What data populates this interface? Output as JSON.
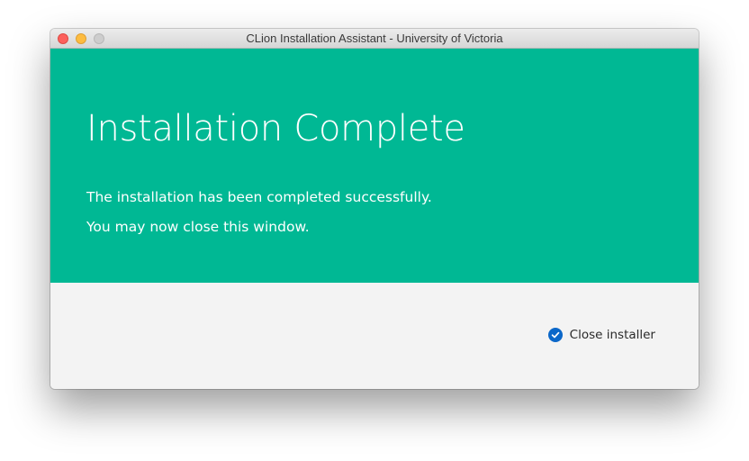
{
  "window": {
    "title": "CLion Installation Assistant - University of Victoria"
  },
  "hero": {
    "title": "Installation Complete",
    "line1": "The installation has been completed successfully.",
    "line2": "You may now close this window."
  },
  "footer": {
    "close_option_label": "Close installer",
    "close_option_checked": true
  },
  "colors": {
    "accent": "#00b894",
    "checkbox": "#0b67c9",
    "footer_bg": "#f3f3f3"
  },
  "icons": {
    "checkbox": "checkmark-icon"
  }
}
